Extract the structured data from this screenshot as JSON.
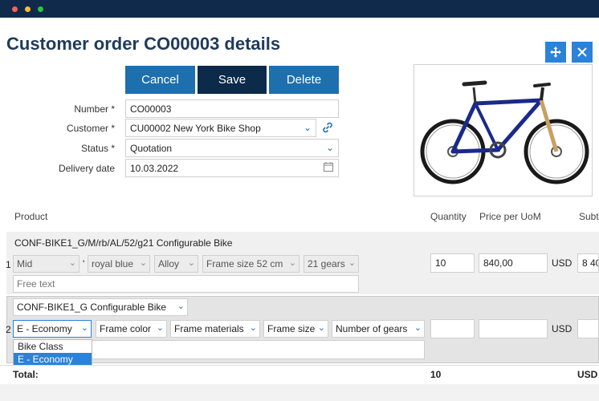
{
  "page": {
    "title": "Customer order CO00003 details"
  },
  "toolbar": {
    "cancel": "Cancel",
    "save": "Save",
    "delete": "Delete"
  },
  "form": {
    "number": {
      "label": "Number *",
      "value": "CO00003"
    },
    "customer": {
      "label": "Customer *",
      "value": "CU00002 New York Bike  Shop"
    },
    "status": {
      "label": "Status *",
      "value": "Quotation"
    },
    "delivery": {
      "label": "Delivery date",
      "value": "10.03.2022"
    }
  },
  "table": {
    "headers": {
      "product": "Product",
      "quantity": "Quantity",
      "price": "Price per UoM",
      "subtotal": "Subt"
    },
    "row1": {
      "num": "1",
      "product": "CONF-BIKE1_G/M/rb/AL/52/g21 Configurable Bike",
      "options": [
        "Mid",
        "royal blue",
        "Alloy",
        "Frame size 52 cm",
        "21 gears"
      ],
      "sep": "'",
      "free_text": "Free text",
      "quantity": "10",
      "price": "840,00",
      "currency": "USD",
      "subtotal": "8 40"
    },
    "row2": {
      "num": "2",
      "product": "CONF-BIKE1_G Configurable Bike",
      "options": [
        "E - Economy",
        "Frame color",
        "Frame materials",
        "Frame size",
        "Number of gears"
      ],
      "currency": "USD",
      "dropdown": [
        "Bike Class",
        "E - Economy"
      ]
    }
  },
  "totals": {
    "label": "Total:",
    "quantity": "10",
    "currency": "USD"
  },
  "colors": {
    "primary": "#1e6fad",
    "dark": "#0c2a4a",
    "title": "#1f3a5c",
    "accent": "#2b82d9",
    "header_bar": "#0f2a4a"
  },
  "icons": {
    "move": "move-icon",
    "close": "close-icon",
    "link": "link-icon",
    "calendar": "calendar-icon"
  }
}
